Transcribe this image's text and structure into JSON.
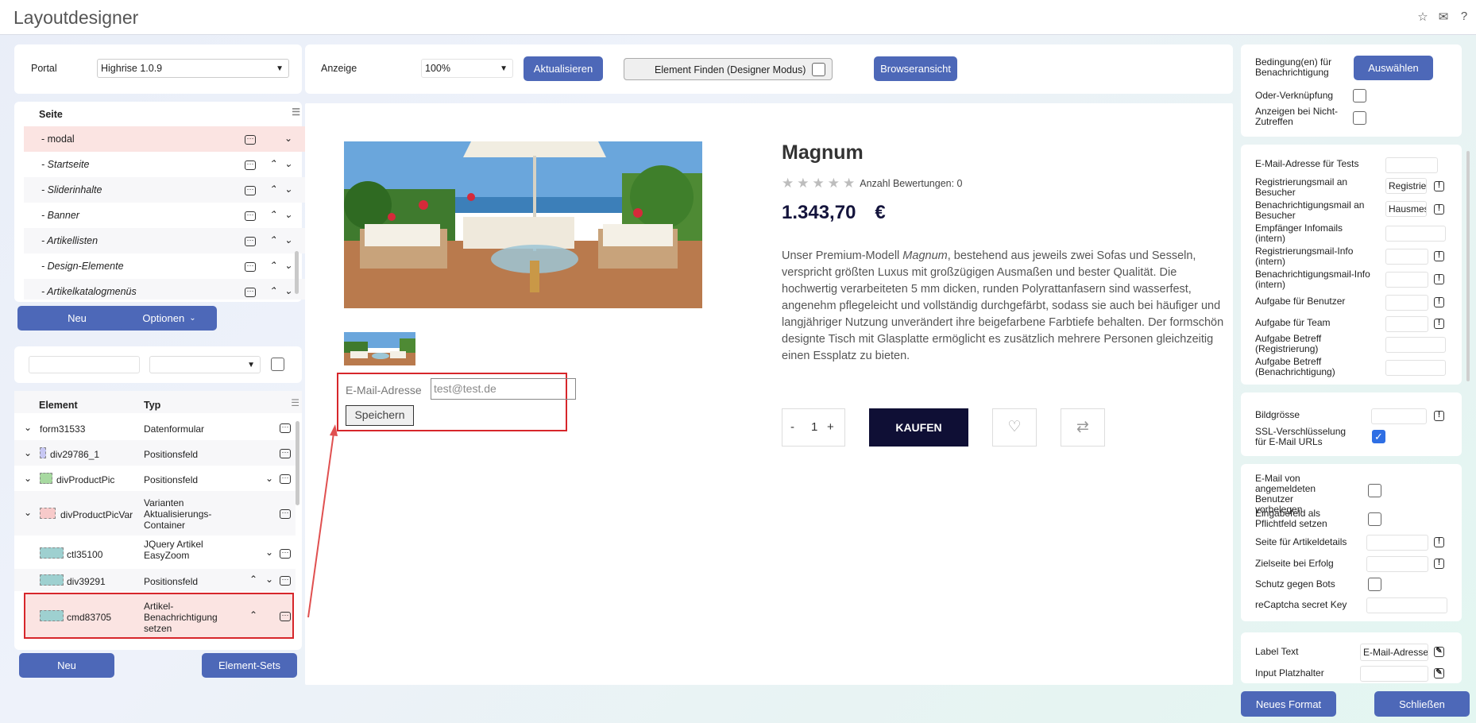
{
  "app": {
    "title": "Layoutdesigner"
  },
  "toolbar": {
    "portal_label": "Portal",
    "portal_value": "Highrise 1.0.9",
    "anzeige_label": "Anzeige",
    "zoom_value": "100%",
    "refresh_label": "Aktualisieren",
    "find_element_label": "Element Finden (Designer Modus)",
    "browser_view_label": "Browseransicht"
  },
  "pages": {
    "header": "Seite",
    "items": [
      {
        "label": "- modal",
        "selected": true
      },
      {
        "label": "- Startseite"
      },
      {
        "label": "- Sliderinhalte"
      },
      {
        "label": "- Banner"
      },
      {
        "label": "- Artikellisten"
      },
      {
        "label": "- Design-Elemente"
      },
      {
        "label": "- Artikelkatalogmenüs"
      }
    ],
    "new_label": "Neu",
    "options_label": "Optionen"
  },
  "elements": {
    "col_element": "Element",
    "col_type": "Typ",
    "rows": [
      {
        "name": "form31533",
        "type": "Datenformular"
      },
      {
        "name": "div29786_1",
        "type": "Positionsfeld"
      },
      {
        "name": "divProductPic",
        "type": "Positionsfeld"
      },
      {
        "name": "divProductPicVar",
        "type": "Varianten Aktualisierungs-Container"
      },
      {
        "name": "ctl35100",
        "type": "JQuery Artikel EasyZoom"
      },
      {
        "name": "div39291",
        "type": "Positionsfeld"
      },
      {
        "name": "cmd83705",
        "type": "Artikel-Benachrichtigung setzen"
      }
    ],
    "new_label": "Neu",
    "sets_label": "Element-Sets"
  },
  "preview": {
    "product_title": "Magnum",
    "ratings_text": "Anzahl Bewertungen: 0",
    "price": "1.343,70",
    "currency": "€",
    "description_before": "Unser Premium-Modell ",
    "description_em": "Magnum",
    "description_after": ", bestehend aus jeweils zwei Sofas und Sesseln, verspricht größten Luxus mit großzügigen Ausmaßen und bester Qualität. Die hochwertig verarbeiteten 5 mm dicken, runden Polyrattanfasern sind wasserfest, angenehm pflegeleicht und vollständig durchgefärbt, sodass sie auch bei häufiger und langjähriger Nutzung unverändert ihre beigefarbene Farbtiefe behalten. Der formschön designte Tisch mit Glasplatte ermöglicht es zusätzlich mehrere Personen gleichzeitig einen Essplatz zu bieten.",
    "qty_minus": "-",
    "qty_value": "1",
    "qty_plus": "+",
    "buy_label": "KAUFEN",
    "email_label": "E-Mail-Adresse",
    "email_value": "test@test.de",
    "save_label": "Speichern",
    "rating_stars": 0
  },
  "props": {
    "g1": {
      "cond_label": "Bedingung(en) für Benachrichtigung",
      "select_label": "Auswählen",
      "or_label": "Oder-Verknüpfung",
      "show_label": "Anzeigen bei Nicht-Zutreffen"
    },
    "g2": [
      {
        "label": "E-Mail-Adresse für Tests",
        "value": ""
      },
      {
        "label": "Registrierungsmail an Besucher",
        "value": "Registrie"
      },
      {
        "label": "Benachrichtigungsmail an Besucher",
        "value": "Hausmes"
      },
      {
        "label": "Empfänger Infomails (intern)",
        "value": ""
      },
      {
        "label": "Registrierungsmail-Info (intern)",
        "value": ""
      },
      {
        "label": "Benachrichtigungsmail-Info (intern)",
        "value": ""
      },
      {
        "label": "Aufgabe für Benutzer",
        "value": ""
      },
      {
        "label": "Aufgabe für Team",
        "value": ""
      },
      {
        "label": "Aufgabe Betreff (Registrierung)",
        "value": ""
      },
      {
        "label": "Aufgabe Betreff (Benachrichtigung)",
        "value": ""
      }
    ],
    "g3": {
      "image_size": "Bildgrösse",
      "ssl": "SSL-Verschlüsselung für E-Mail URLs"
    },
    "g4": {
      "prefill": "E-Mail von angemeldeten Benutzer vorbelegen",
      "required": "Eingabefeld als Pflichtfeld setzen",
      "article_page": "Seite für Artikeldetails",
      "success_page": "Zielseite bei Erfolg",
      "bots": "Schutz gegen Bots",
      "recaptcha": "reCaptcha secret Key"
    },
    "g5": {
      "label_text": "Label Text",
      "label_value": "E-Mail-Adresse",
      "placeholder": "Input Platzhalter"
    }
  },
  "footer": {
    "new_format": "Neues Format",
    "close": "Schließen"
  }
}
